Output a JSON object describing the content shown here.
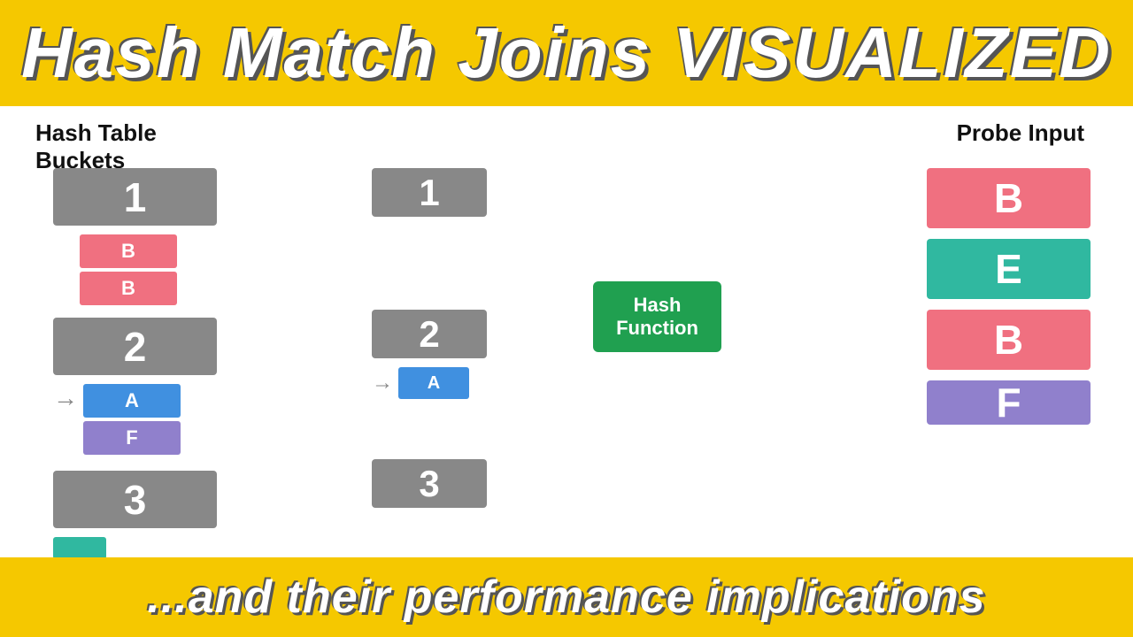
{
  "top_banner": {
    "title": "Hash Match Joins  VISUALIZED"
  },
  "bottom_banner": {
    "subtitle": "...and their performance implications"
  },
  "hash_table_label": "Hash Table\nBuckets",
  "probe_input_label": "Probe Input",
  "left_col": {
    "buckets": [
      "1",
      "2",
      "3"
    ],
    "bucket1_items": [
      {
        "label": "B",
        "color": "pink"
      },
      {
        "label": "B",
        "color": "pink"
      }
    ],
    "bucket2_items": [
      {
        "label": "A",
        "color": "blue"
      },
      {
        "label": "F",
        "color": "purple"
      }
    ]
  },
  "middle_col": {
    "buckets": [
      "1",
      "2",
      "3"
    ],
    "bucket2_item": {
      "label": "A",
      "color": "blue"
    }
  },
  "hash_function": {
    "label": "Hash\nFunction"
  },
  "probe_input": {
    "items": [
      {
        "label": "B",
        "color": "pink"
      },
      {
        "label": "E",
        "color": "teal"
      },
      {
        "label": "B",
        "color": "pink"
      },
      {
        "label": "F",
        "color": "lavender"
      }
    ]
  }
}
